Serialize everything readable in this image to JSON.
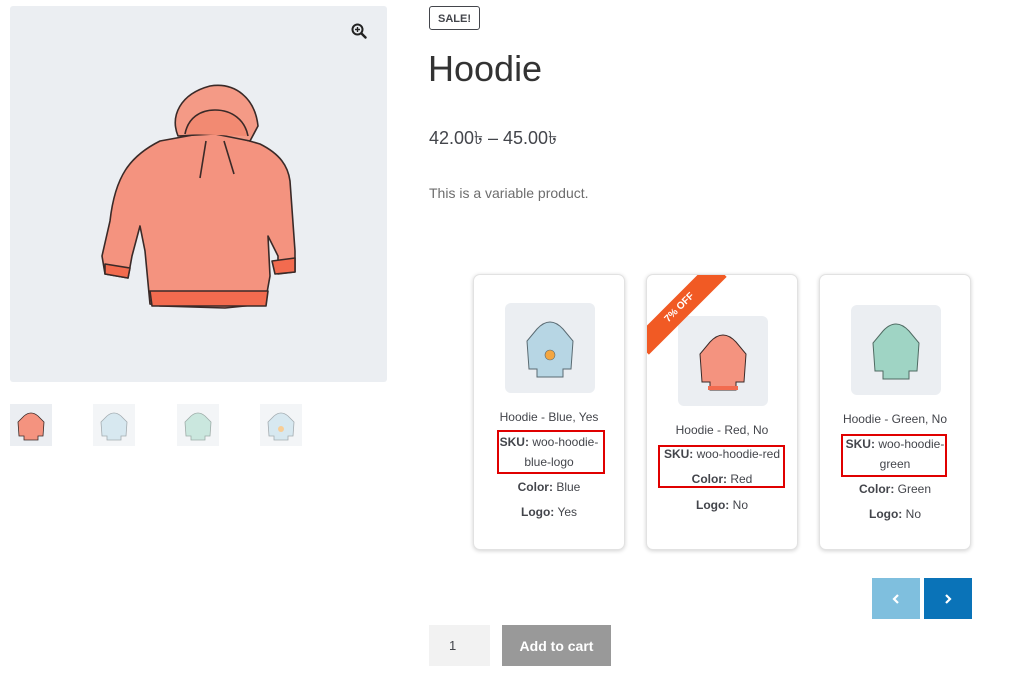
{
  "product": {
    "badge": "SALE!",
    "title": "Hoodie",
    "price": "42.00৳ – 45.00৳",
    "description": "This is a variable product."
  },
  "gallery": {
    "thumbnails": [
      {
        "name": "thumbnail-red-hoodie",
        "color": "#f4937f"
      },
      {
        "name": "thumbnail-blue-hoodie",
        "color": "#b7d6e4"
      },
      {
        "name": "thumbnail-green-hoodie",
        "color": "#9fd4c4"
      },
      {
        "name": "thumbnail-blue-logo-hoodie",
        "color": "#b7d6e4"
      }
    ]
  },
  "variations": [
    {
      "name": "Hoodie - Blue, Yes",
      "sku_label": "SKU:",
      "sku_line1": "woo-hoodie-",
      "sku_line2": "blue-logo",
      "color_label": "Color:",
      "color_value": "Blue",
      "logo_label": "Logo:",
      "logo_value": "Yes",
      "hoodie_color": "#b7d6e4"
    },
    {
      "name": "Hoodie - Red, No",
      "sku_label": "SKU:",
      "sku_value": "woo-hoodie-red",
      "color_label": "Color:",
      "color_value": "Red",
      "logo_label": "Logo:",
      "logo_value": "No",
      "discount": "7% OFF",
      "hoodie_color": "#f4937f"
    },
    {
      "name": "Hoodie - Green, No",
      "sku_label": "SKU:",
      "sku_line1": "woo-hoodie-",
      "sku_line2": "green",
      "color_label": "Color:",
      "color_value": "Green",
      "logo_label": "Logo:",
      "logo_value": "No",
      "hoodie_color": "#9fd4c4"
    }
  ],
  "cart": {
    "quantity": "1",
    "add_to_cart": "Add to cart"
  },
  "colors": {
    "accent": "#0a73b8",
    "accent_light": "#7fbfde",
    "ribbon": "#f15a24",
    "highlight": "#e00000"
  }
}
